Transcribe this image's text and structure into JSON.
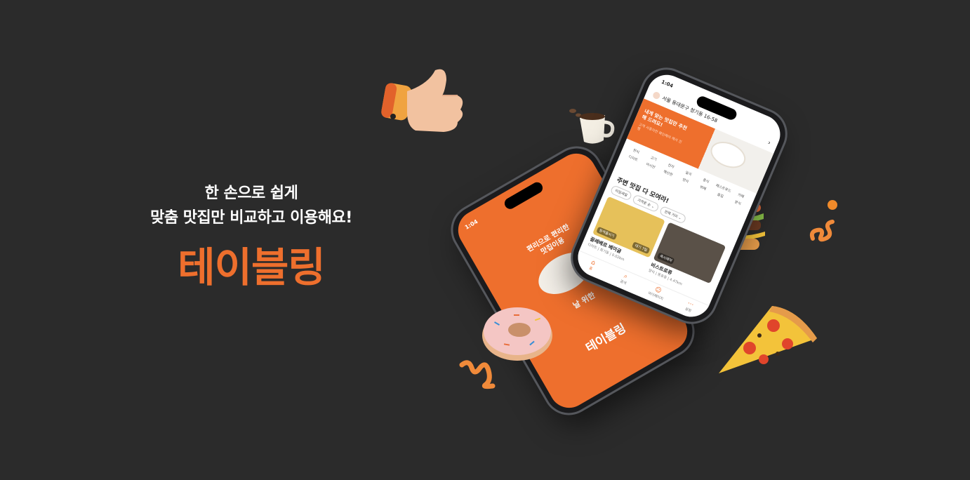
{
  "hero": {
    "tagline_line1": "한 손으로 쉽게",
    "tagline_line2": "맞춤 맛집만 비교하고 이용해요!",
    "brand": "테이블링",
    "brand_color": "#ee6f2d"
  },
  "back_phone": {
    "time": "1:04",
    "slogan_line1": "편리으로 편리한",
    "slogan_line2": "맛집이용",
    "cut_text": "날 위한",
    "logo": "테이블링"
  },
  "front_phone": {
    "time": "1:04",
    "address": "서울 동대문구 청기동 16-58",
    "banner_title": "내게 맞는 맛집만 추천해 드려요!",
    "banner_sub": "고객 사용자만 확인해야 해서 진행",
    "categories": [
      "한식",
      "고기",
      "전자",
      "일식",
      "중식",
      "패스트푸드",
      "카페",
      "디저트",
      "아시안",
      "해산한",
      "양식",
      "뷔페",
      "술집",
      "분식"
    ],
    "section_title": "주변 맛집 다 모여라!",
    "filters": [
      "타임세일",
      "가까운 순 ⌄",
      "전체 거리 ⌄"
    ],
    "cards": [
      {
        "name": "끌레베르 베이글",
        "meta": "디저트 | 회기동 | 0.02km",
        "badge": "원격줄서기",
        "badge2": "대기 7팀"
      },
      {
        "name": "비스트로류",
        "meta": "양식 | 동숭동 | 4.47km",
        "badge": "즉시예약",
        "badge2": ""
      }
    ],
    "tabs": [
      {
        "icon": "⌂",
        "label": "홈"
      },
      {
        "icon": "⌕",
        "label": "검색"
      },
      {
        "icon": "☺",
        "label": "마이페이지"
      },
      {
        "icon": "⋯",
        "label": "설정"
      }
    ]
  }
}
